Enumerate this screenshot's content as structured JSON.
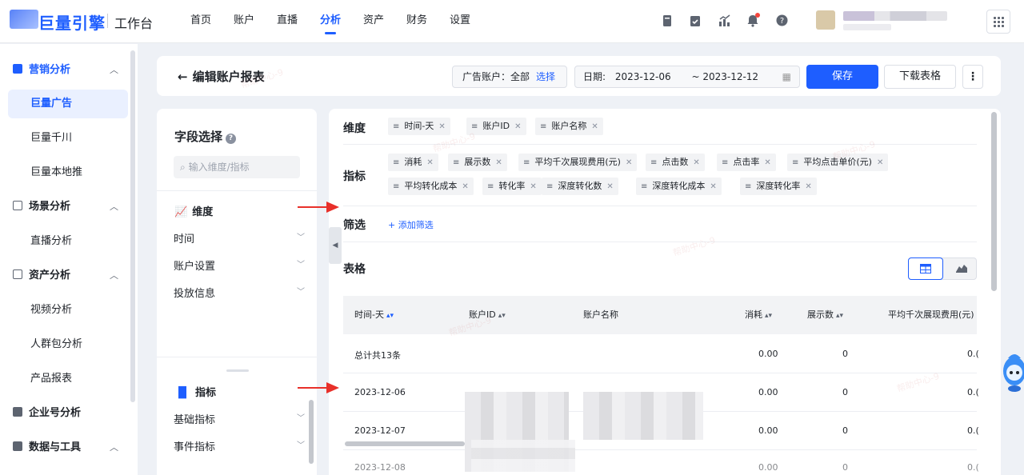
{
  "topbar": {
    "logo": "巨量引擎",
    "workbench": "工作台",
    "nav": [
      "首页",
      "账户",
      "直播",
      "分析",
      "资产",
      "财务",
      "设置"
    ],
    "active_nav": "分析",
    "icons": [
      "book-icon",
      "clipboard-icon",
      "chart-up-icon",
      "bell-icon",
      "help-icon"
    ],
    "apps_icon": "grid-icon"
  },
  "sidebar": {
    "groups": [
      {
        "label": "营销分析",
        "icon": "marketing-icon",
        "expanded": true,
        "items": [
          "巨量广告",
          "巨量千川",
          "巨量本地推"
        ]
      },
      {
        "label": "场景分析",
        "icon": "scene-icon",
        "expanded": true,
        "items": [
          "直播分析"
        ]
      },
      {
        "label": "资产分析",
        "icon": "asset-icon",
        "expanded": true,
        "items": [
          "视频分析",
          "人群包分析",
          "产品报表"
        ]
      },
      {
        "label": "企业号分析",
        "icon": "enterprise-icon",
        "expanded": false,
        "items": []
      },
      {
        "label": "数据与工具",
        "icon": "tools-icon",
        "expanded": true,
        "items": []
      }
    ],
    "active_item": "巨量广告"
  },
  "header": {
    "back_label": "编辑账户报表",
    "account_label": "广告账户：",
    "account_value": "全部",
    "account_select": "选择",
    "date_label": "日期:",
    "date_start": "2023-12-06",
    "date_end": "~ 2023-12-12",
    "save_label": "保存",
    "download_label": "下载表格",
    "more_label": "⋮"
  },
  "field_panel": {
    "title": "字段选择",
    "search_placeholder": "输入维度/指标",
    "dimension_title": "维度",
    "dimension_groups": [
      "时间",
      "账户设置",
      "投放信息"
    ],
    "metric_title": "指标",
    "metric_groups": [
      "基础指标",
      "事件指标"
    ]
  },
  "config": {
    "dimension_label": "维度",
    "dimensions": [
      "时间-天",
      "账户ID",
      "账户名称"
    ],
    "metric_label": "指标",
    "metrics_row1": [
      "消耗",
      "展示数",
      "平均千次展现费用(元)",
      "点击数",
      "点击率",
      "平均点击单价(元)"
    ],
    "metrics_row2": [
      "平均转化成本",
      "转化率",
      "深度转化数",
      "深度转化成本",
      "深度转化率"
    ],
    "filter_label": "筛选",
    "add_filter": "+ 添加筛选",
    "table_label": "表格"
  },
  "table": {
    "columns": [
      "时间-天",
      "账户ID",
      "账户名称",
      "消耗",
      "展示数",
      "平均千次展现费用(元)"
    ],
    "rows": [
      {
        "date": "总计共13条",
        "cost": "0.00",
        "impressions": "0",
        "cpm": "0.("
      },
      {
        "date": "2023-12-06",
        "cost": "0.00",
        "impressions": "0",
        "cpm": "0.("
      },
      {
        "date": "2023-12-07",
        "cost": "0.00",
        "impressions": "0",
        "cpm": "0.("
      },
      {
        "date": "2023-12-08",
        "cost": "0.00",
        "impressions": "0",
        "cpm": "0.("
      }
    ]
  },
  "watermark": "帮助中心-9",
  "colors": {
    "accent": "#1e5eff",
    "arrow": "#e8302a"
  }
}
